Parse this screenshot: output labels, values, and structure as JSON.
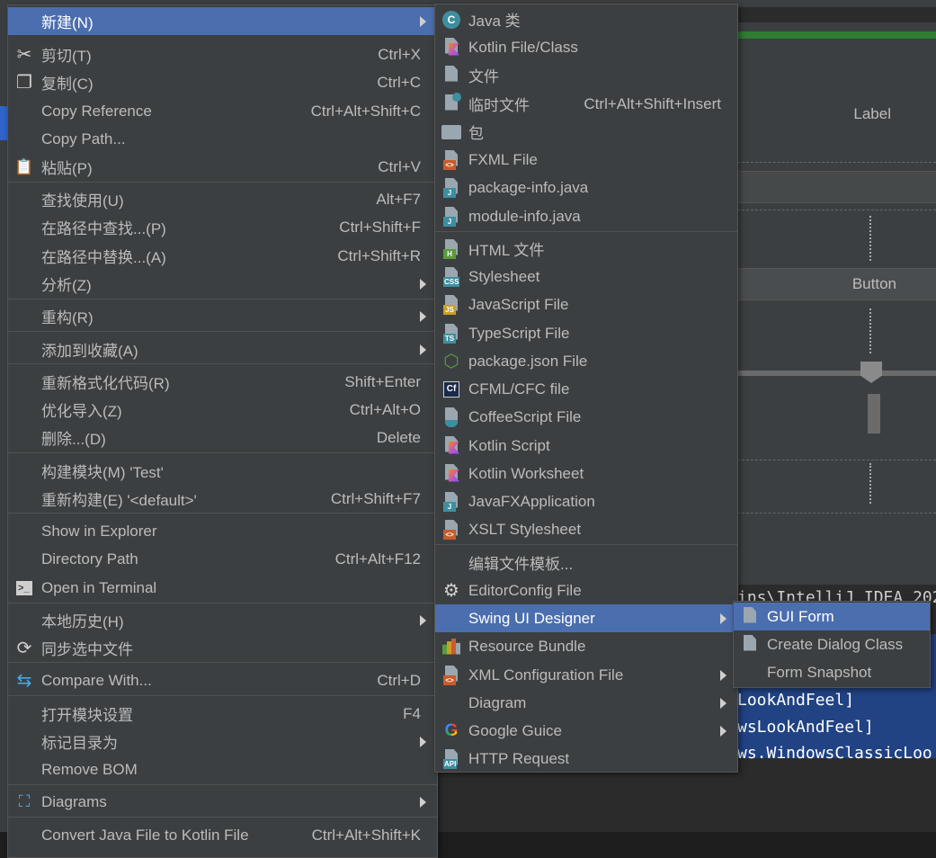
{
  "main_menu": {
    "items": [
      {
        "label": "新建(N)",
        "shortcut": "",
        "icon": "",
        "submenu": true,
        "selected": true
      },
      {
        "label": "剪切(T)",
        "shortcut": "Ctrl+X",
        "icon": "scissors-icon"
      },
      {
        "label": "复制(C)",
        "shortcut": "Ctrl+C",
        "icon": "copy-icon"
      },
      {
        "label": "Copy Reference",
        "shortcut": "Ctrl+Alt+Shift+C"
      },
      {
        "label": "Copy Path...",
        "shortcut": ""
      },
      {
        "label": "粘贴(P)",
        "shortcut": "Ctrl+V",
        "icon": "paste-icon"
      },
      {
        "label": "查找使用(U)",
        "shortcut": "Alt+F7"
      },
      {
        "label": "在路径中查找...(P)",
        "shortcut": "Ctrl+Shift+F"
      },
      {
        "label": "在路径中替换...(A)",
        "shortcut": "Ctrl+Shift+R"
      },
      {
        "label": "分析(Z)",
        "shortcut": "",
        "submenu": true
      },
      {
        "label": "重构(R)",
        "shortcut": "",
        "submenu": true
      },
      {
        "label": "添加到收藏(A)",
        "shortcut": "",
        "submenu": true
      },
      {
        "label": "重新格式化代码(R)",
        "shortcut": "Shift+Enter"
      },
      {
        "label": "优化导入(Z)",
        "shortcut": "Ctrl+Alt+O"
      },
      {
        "label": "删除...(D)",
        "shortcut": "Delete"
      },
      {
        "label": "构建模块(M) 'Test'",
        "shortcut": ""
      },
      {
        "label": "重新构建(E) '<default>'",
        "shortcut": "Ctrl+Shift+F7"
      },
      {
        "label": "Show in Explorer",
        "shortcut": ""
      },
      {
        "label": "Directory Path",
        "shortcut": "Ctrl+Alt+F12"
      },
      {
        "label": "Open in Terminal",
        "shortcut": "",
        "icon": "terminal-icon"
      },
      {
        "label": "本地历史(H)",
        "shortcut": "",
        "submenu": true
      },
      {
        "label": "同步选中文件",
        "shortcut": "",
        "icon": "sync-icon"
      },
      {
        "label": "Compare With...",
        "shortcut": "Ctrl+D",
        "icon": "compare-icon"
      },
      {
        "label": "打开模块设置",
        "shortcut": "F4"
      },
      {
        "label": "标记目录为",
        "shortcut": "",
        "submenu": true
      },
      {
        "label": "Remove BOM",
        "shortcut": ""
      },
      {
        "label": "Diagrams",
        "shortcut": "",
        "submenu": true,
        "icon": "diagram-icon"
      },
      {
        "label": "Convert Java File to Kotlin File",
        "shortcut": "Ctrl+Alt+Shift+K"
      }
    ]
  },
  "new_menu": {
    "items": [
      {
        "label": "Java 类",
        "shortcut": "",
        "icon": "java-class-icon"
      },
      {
        "label": "Kotlin File/Class",
        "shortcut": "",
        "icon": "kotlin-file-icon"
      },
      {
        "label": "文件",
        "shortcut": "",
        "icon": "file-icon"
      },
      {
        "label": "临时文件",
        "shortcut": "Ctrl+Alt+Shift+Insert",
        "icon": "scratch-file-icon"
      },
      {
        "label": "包",
        "shortcut": "",
        "icon": "package-icon"
      },
      {
        "label": "FXML File",
        "shortcut": "",
        "icon": "fxml-file-icon"
      },
      {
        "label": "package-info.java",
        "shortcut": "",
        "icon": "java-file-icon"
      },
      {
        "label": "module-info.java",
        "shortcut": "",
        "icon": "java-file-icon"
      },
      {
        "label": "HTML 文件",
        "shortcut": "",
        "icon": "html-file-icon"
      },
      {
        "label": "Stylesheet",
        "shortcut": "",
        "icon": "css-file-icon"
      },
      {
        "label": "JavaScript File",
        "shortcut": "",
        "icon": "js-file-icon"
      },
      {
        "label": "TypeScript File",
        "shortcut": "",
        "icon": "ts-file-icon"
      },
      {
        "label": "package.json File",
        "shortcut": "",
        "icon": "nodejs-icon"
      },
      {
        "label": "CFML/CFC file",
        "shortcut": "",
        "icon": "cfml-icon"
      },
      {
        "label": "CoffeeScript File",
        "shortcut": "",
        "icon": "coffeescript-icon"
      },
      {
        "label": "Kotlin Script",
        "shortcut": "",
        "icon": "kotlin-script-icon"
      },
      {
        "label": "Kotlin Worksheet",
        "shortcut": "",
        "icon": "kotlin-worksheet-icon"
      },
      {
        "label": "JavaFXApplication",
        "shortcut": "",
        "icon": "java-file-icon"
      },
      {
        "label": "XSLT Stylesheet",
        "shortcut": "",
        "icon": "xslt-file-icon"
      },
      {
        "label": "编辑文件模板...",
        "shortcut": ""
      },
      {
        "label": "EditorConfig File",
        "shortcut": "",
        "icon": "gear-icon"
      },
      {
        "label": "Swing UI Designer",
        "shortcut": "",
        "submenu": true,
        "selected": true
      },
      {
        "label": "Resource Bundle",
        "shortcut": "",
        "icon": "resource-bundle-icon"
      },
      {
        "label": "XML Configuration File",
        "shortcut": "",
        "submenu": true,
        "icon": "xml-file-icon"
      },
      {
        "label": "Diagram",
        "shortcut": "",
        "submenu": true
      },
      {
        "label": "Google Guice",
        "shortcut": "",
        "submenu": true,
        "icon": "google-icon"
      },
      {
        "label": "HTTP Request",
        "shortcut": "",
        "icon": "api-icon"
      }
    ]
  },
  "swing_menu": {
    "items": [
      {
        "label": "GUI Form",
        "icon": "form-icon",
        "selected": true
      },
      {
        "label": "Create Dialog Class",
        "icon": "form-icon"
      },
      {
        "label": "Form Snapshot",
        "icon": ""
      }
    ]
  },
  "designer": {
    "label_text": "Label",
    "button_text": "Button"
  },
  "console": {
    "lines": [
      "ins\\IntelliJ IDEA 202",
      "LookAndFeel]",
      "wsLookAndFeel]",
      "ws.WindowsClassicLoo"
    ]
  },
  "colors": {
    "menu_bg": "#3c3f41",
    "selection": "#4b6eaf",
    "separator": "#515151",
    "text": "#bbbbbb"
  }
}
